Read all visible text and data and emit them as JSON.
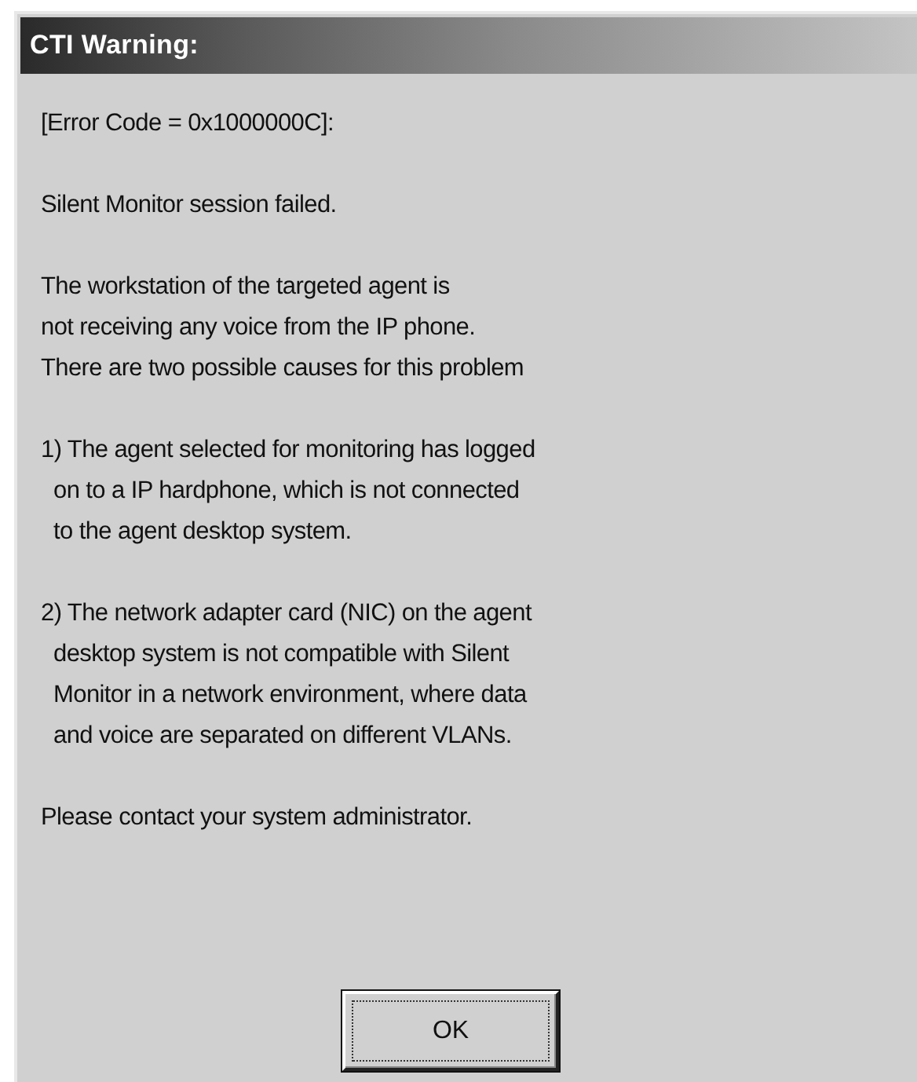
{
  "window": {
    "title": "CTI Warning:"
  },
  "paragraphs": [
    [
      "[Error Code = 0x1000000C]:"
    ],
    [
      "Silent Monitor session failed."
    ],
    [
      "The workstation of the targeted agent is",
      "not receiving any voice from the IP phone.",
      "There are two possible causes for this problem"
    ],
    [
      "1) The agent selected for monitoring has logged",
      "  on to a IP hardphone, which is not connected",
      "  to the agent desktop system."
    ],
    [
      "2) The network adapter card (NIC) on the agent",
      "  desktop system is not compatible with Silent",
      "  Monitor in a network environment, where data",
      "  and voice are separated on different VLANs."
    ],
    [
      "Please contact your system administrator."
    ]
  ],
  "buttons": [
    "OK"
  ]
}
